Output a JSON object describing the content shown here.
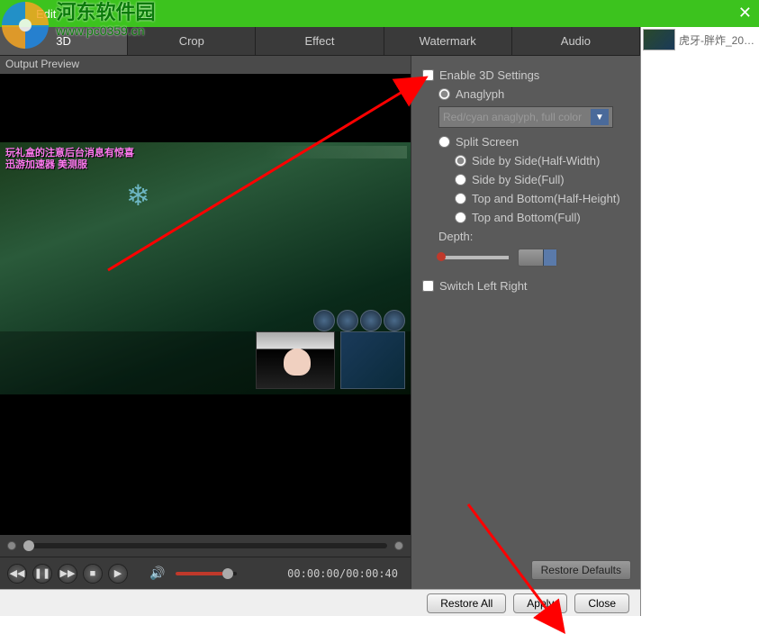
{
  "window": {
    "title": "Edit"
  },
  "watermark": {
    "cn": "河东软件园",
    "url": "www.pc0359.cn"
  },
  "tabs": {
    "t3d": "3D",
    "crop": "Crop",
    "effect": "Effect",
    "watermark": "Watermark",
    "audio": "Audio"
  },
  "preview": {
    "label": "Output Preview",
    "game_text_line1": "玩礼盒的注意后台消息有惊喜",
    "game_text_line2": "迅游加速器 美测服",
    "timecode": "00:00:00/00:00:40"
  },
  "settings": {
    "enable3d": "Enable 3D Settings",
    "anaglyph": "Anaglyph",
    "anaglyph_option": "Red/cyan anaglyph, full color",
    "split": "Split Screen",
    "sbs_half": "Side by Side(Half-Width)",
    "sbs_full": "Side by Side(Full)",
    "tb_half": "Top and Bottom(Half-Height)",
    "tb_full": "Top and Bottom(Full)",
    "depth_label": "Depth:",
    "switch_lr": "Switch Left Right",
    "restore_defaults": "Restore Defaults"
  },
  "footer": {
    "restore_all": "Restore All",
    "apply": "Apply",
    "close": "Close"
  },
  "sidebar": {
    "item_label": "虎牙-胖炸_20…"
  }
}
